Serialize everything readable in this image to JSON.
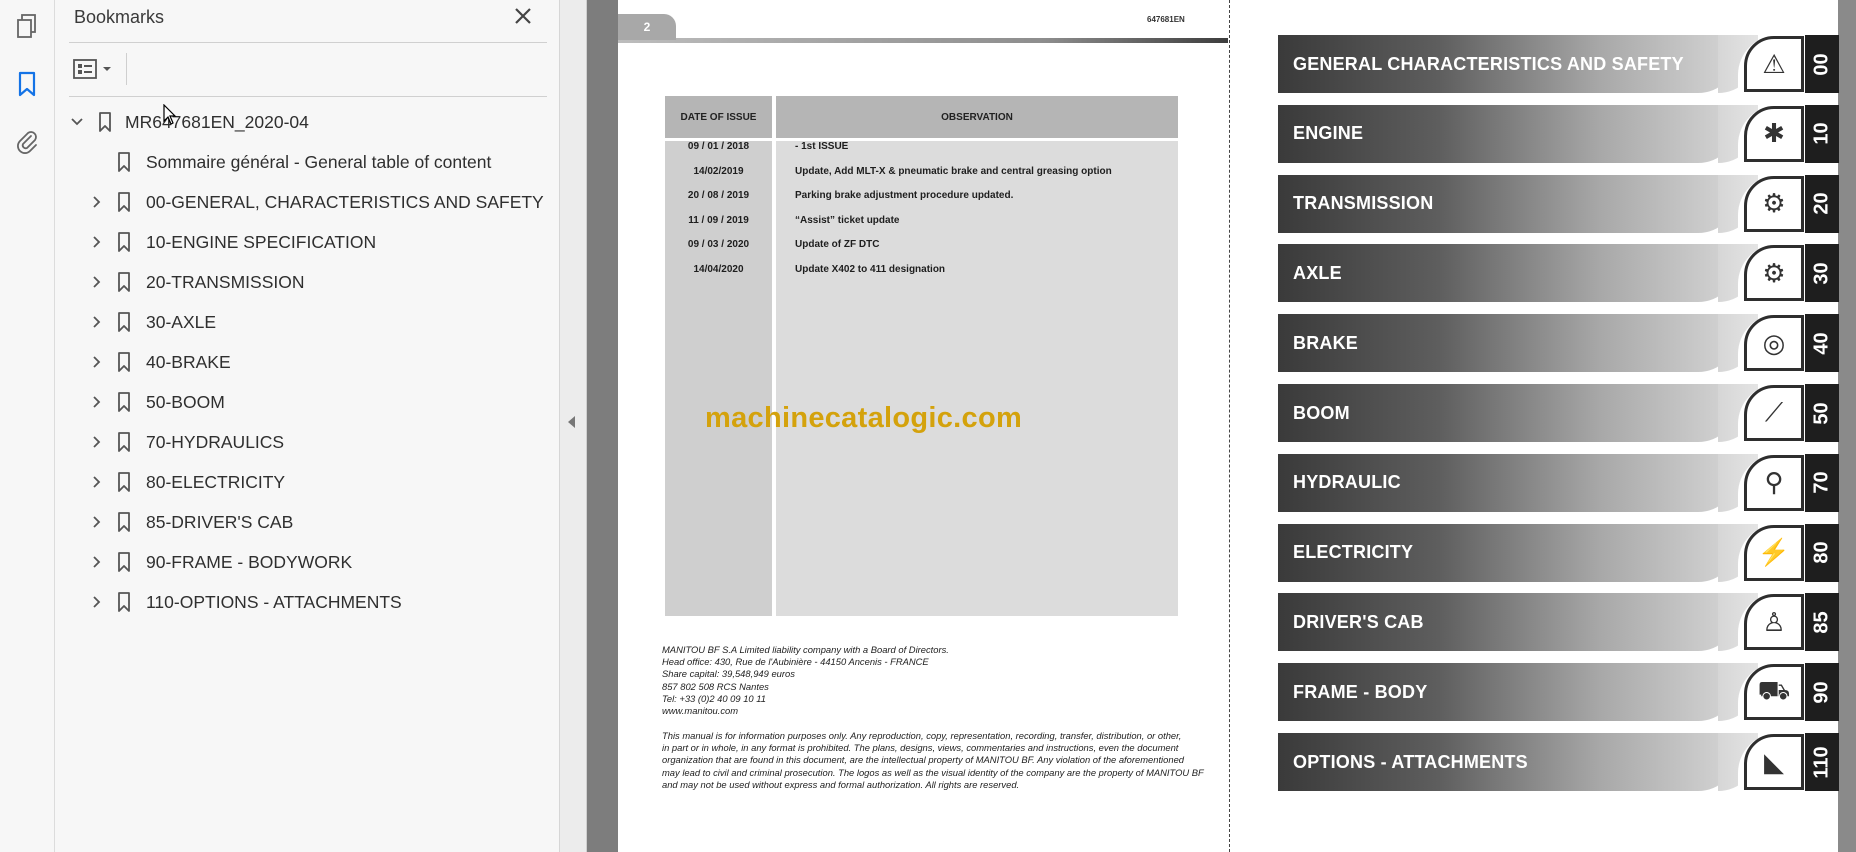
{
  "panel": {
    "title": "Bookmarks",
    "root": "MR647681EN_2020-04",
    "items": [
      {
        "label": "Sommaire général - General table of content",
        "expandable": false
      },
      {
        "label": "00-GENERAL, CHARACTERISTICS AND SAFETY",
        "expandable": true
      },
      {
        "label": "10-ENGINE SPECIFICATION",
        "expandable": true
      },
      {
        "label": "20-TRANSMISSION",
        "expandable": true
      },
      {
        "label": "30-AXLE",
        "expandable": true
      },
      {
        "label": "40-BRAKE",
        "expandable": true
      },
      {
        "label": "50-BOOM",
        "expandable": true
      },
      {
        "label": "70-HYDRAULICS",
        "expandable": true
      },
      {
        "label": "80-ELECTRICITY",
        "expandable": true
      },
      {
        "label": "85-DRIVER'S CAB",
        "expandable": true
      },
      {
        "label": "90-FRAME - BODYWORK",
        "expandable": true
      },
      {
        "label": "110-OPTIONS - ATTACHMENTS",
        "expandable": true
      }
    ]
  },
  "page": {
    "number": "2",
    "ref": "647681EN",
    "table": {
      "col1": "DATE OF ISSUE",
      "col2": "OBSERVATION",
      "rows": [
        {
          "date": "09 / 01 / 2018",
          "obs": "- 1st ISSUE"
        },
        {
          "date": "14/02/2019",
          "obs": "Update, Add MLT-X & pneumatic brake and central greasing option"
        },
        {
          "date": "20 / 08 / 2019",
          "obs": "Parking brake adjustment procedure updated."
        },
        {
          "date": "11 / 09 / 2019",
          "obs": "“Assist” ticket update"
        },
        {
          "date": "09 / 03 / 2020",
          "obs": "Update of ZF DTC"
        },
        {
          "date": "14/04/2020",
          "obs": "Update X402 to 411 designation"
        }
      ]
    },
    "watermark": "machinecatalogic.com",
    "company": [
      "MANITOU BF S.A Limited liability company with a Board of Directors.",
      "Head office: 430, Rue de l'Aubinière - 44150 Ancenis - FRANCE",
      "Share capital: 39,548,949 euros",
      "857 802 508 RCS Nantes",
      "Tel: +33 (0)2 40 09 10 11",
      "www.manitou.com"
    ],
    "disclaimer": [
      "This manual is for information purposes only. Any reproduction, copy, representation, recording, transfer, distribution, or other,",
      "in part or in whole, in any format is prohibited. The plans, designs, views, commentaries and instructions, even the document",
      "organization that are found in this document, are the intellectual property of MANITOU BF. Any violation of the aforementioned",
      "may lead to civil and criminal prosecution. The logos as well as the visual identity of the company are the property of MANITOU BF",
      "and may not be used without express and formal authorization. All rights are reserved."
    ],
    "sections": [
      {
        "label": "GENERAL CHARACTERISTICS AND SAFETY",
        "num": "00",
        "icon": "⚠"
      },
      {
        "label": "ENGINE",
        "num": "10",
        "icon": "✱"
      },
      {
        "label": "TRANSMISSION",
        "num": "20",
        "icon": "⚙"
      },
      {
        "label": "AXLE",
        "num": "30",
        "icon": "⚙"
      },
      {
        "label": "BRAKE",
        "num": "40",
        "icon": "◎"
      },
      {
        "label": "BOOM",
        "num": "50",
        "icon": "⟋"
      },
      {
        "label": "HYDRAULIC",
        "num": "70",
        "icon": "⚲"
      },
      {
        "label": "ELECTRICITY",
        "num": "80",
        "icon": "⚡"
      },
      {
        "label": "DRIVER'S CAB",
        "num": "85",
        "icon": "♙"
      },
      {
        "label": "FRAME - BODY",
        "num": "90",
        "icon": "⛟"
      },
      {
        "label": "OPTIONS - ATTACHMENTS",
        "num": "110",
        "icon": "◣"
      }
    ]
  }
}
